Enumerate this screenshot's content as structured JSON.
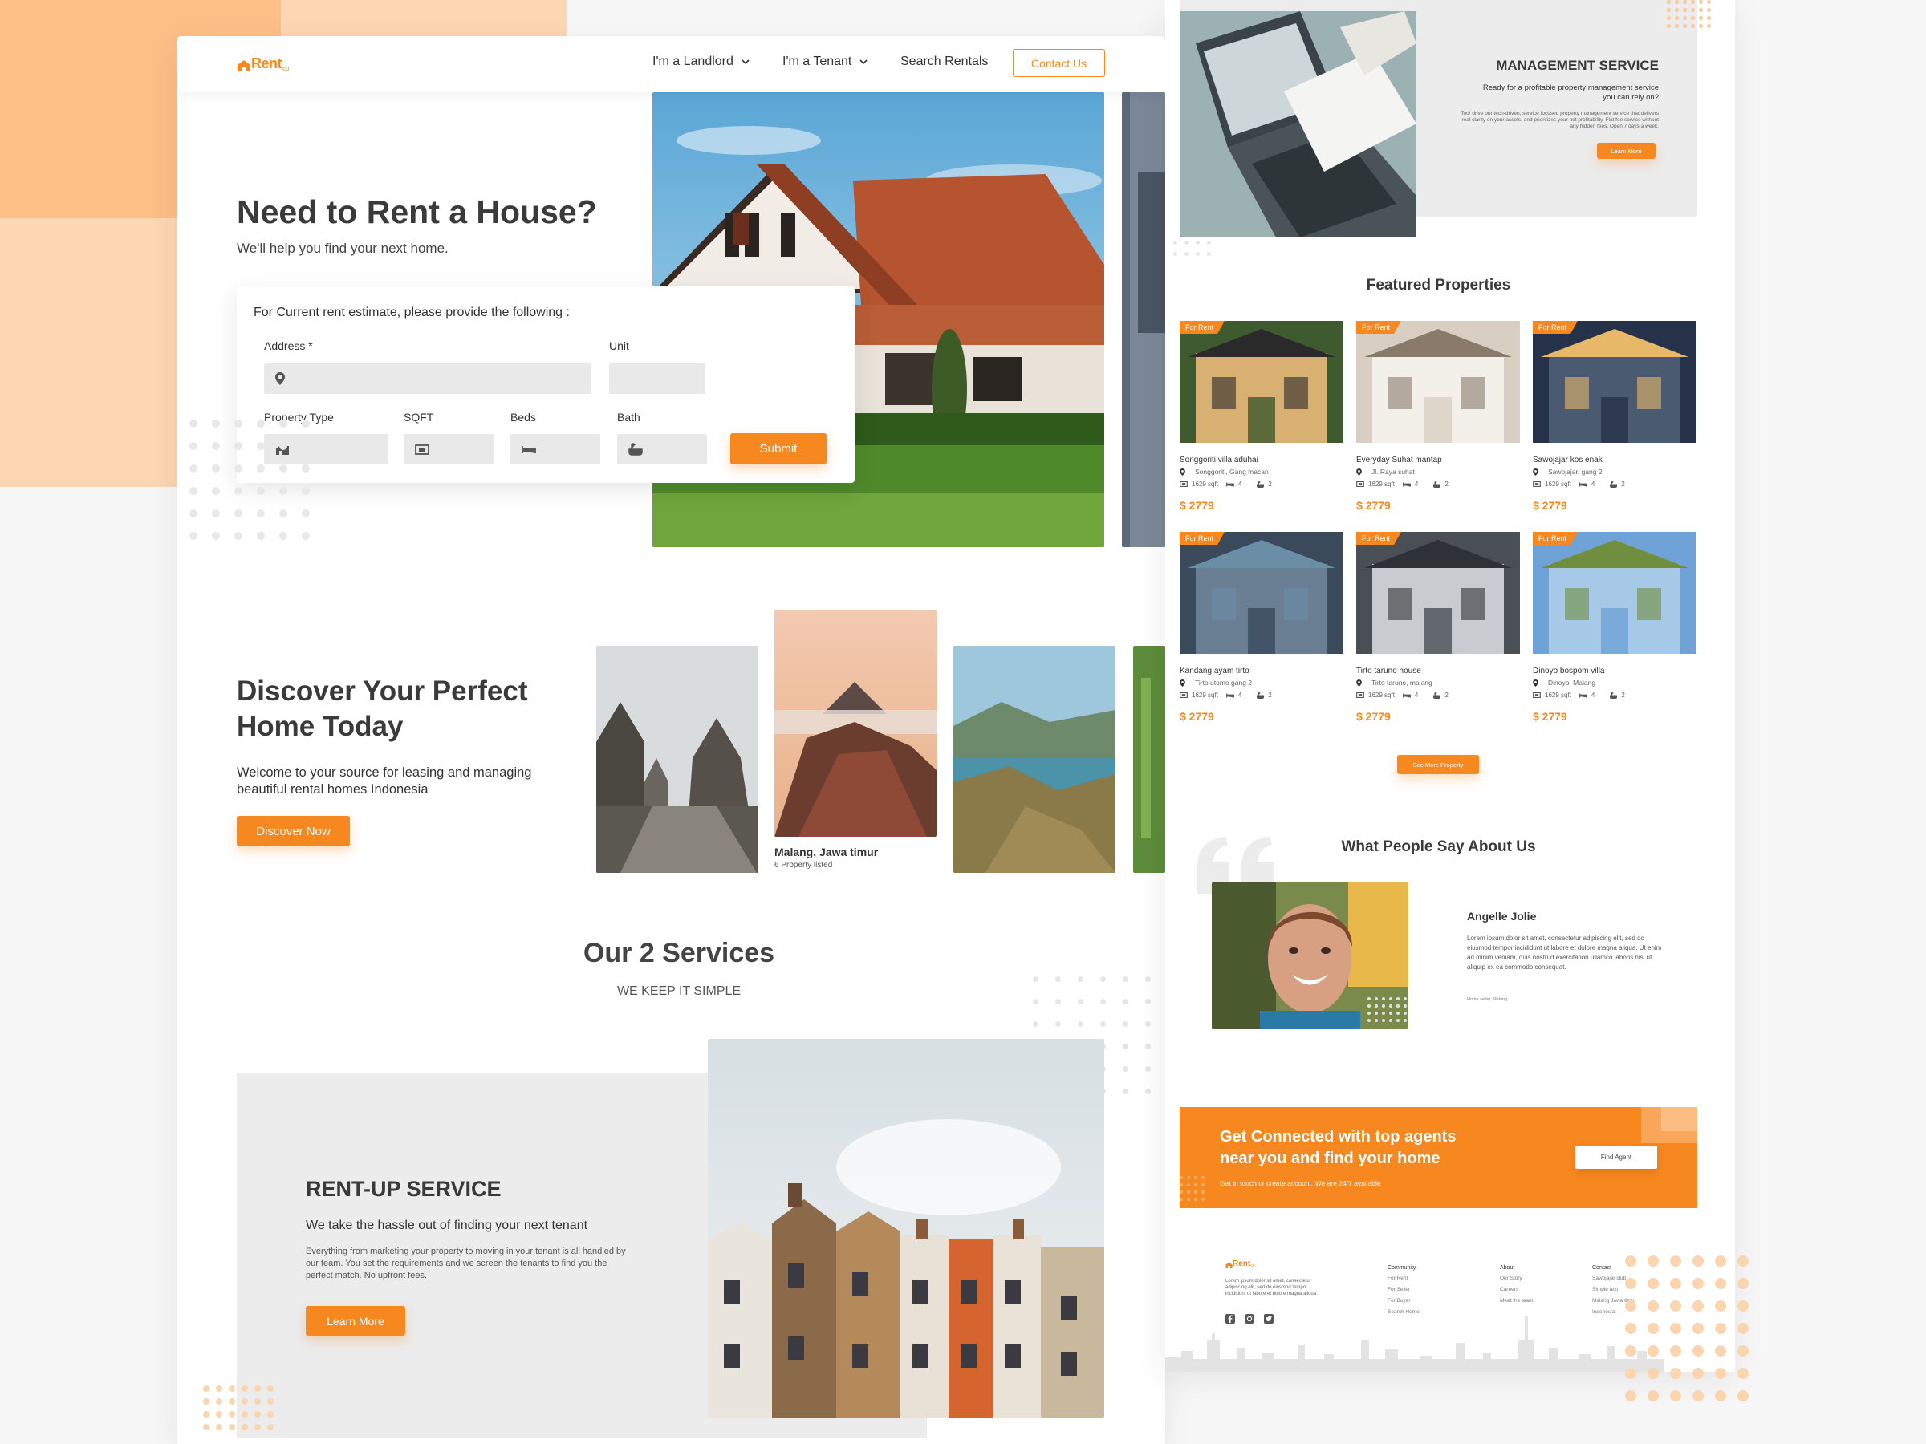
{
  "brand": {
    "logo": "Rent",
    "logo_suffix": "co",
    "accent": "#f7871f"
  },
  "nav": {
    "items": [
      {
        "label": "I'm a Landlord",
        "dropdown": true
      },
      {
        "label": "I'm a Tenant",
        "dropdown": true
      },
      {
        "label": "Search Rentals",
        "dropdown": false
      }
    ],
    "contact": "Contact Us"
  },
  "hero": {
    "title": "Need to Rent a House?",
    "subtitle": "We'll help you find your next home."
  },
  "estimate_form": {
    "intro": "For Current rent estimate, please provide the following :",
    "address_label": "Address *",
    "unit_label": "Unit",
    "property_type_label": "Property Type",
    "sqft_label": "SQFT",
    "beds_label": "Beds",
    "bath_label": "Bath",
    "submit": "Submit"
  },
  "discover": {
    "title_line1": "Discover Your Perfect",
    "title_line2": "Home Today",
    "text_line1": "Welcome to your source for leasing and managing",
    "text_line2": "beautiful rental homes Indonesia",
    "button": "Discover Now",
    "featured_location": "Malang, Jawa timur",
    "featured_count": "6 Property listed"
  },
  "services": {
    "title": "Our 2 Services",
    "subtitle": "WE KEEP IT SIMPLE",
    "rentup": {
      "title": "RENT-UP SERVICE",
      "subtitle": "We take the hassle out of finding your next tenant",
      "body": "Everything from marketing your property to moving in your tenant is all handled by our team. You set the requirements and we screen the tenants to find you the perfect match. No upfront fees.",
      "button": "Learn More"
    },
    "management": {
      "title": "MANAGEMENT SERVICE",
      "subtitle": "Ready for a profitable property management service you can rely on?",
      "body": "Too! drive our tech-driven, service focused property management service that delivers real clarity on your assets, and prioritizes your net profitability. Flat fee service without any hidden fees. Open 7 days a week.",
      "button": "Learn More"
    }
  },
  "featured": {
    "title": "Featured Properties",
    "tag": "For Rent",
    "see_more": "See More Property",
    "properties": [
      {
        "name": "Songgoriti villa aduhai",
        "location": "Songgoriti, Gang macan",
        "sqft": "1629 sqft",
        "beds": "4",
        "baths": "2",
        "price": "$ 2779"
      },
      {
        "name": "Everyday Suhat mantap",
        "location": "Jl. Raya suhat",
        "sqft": "1629 sqft",
        "beds": "4",
        "baths": "2",
        "price": "$ 2779"
      },
      {
        "name": "Sawojajar kos enak",
        "location": "Sawojajar, gang 2",
        "sqft": "1629 sqft",
        "beds": "4",
        "baths": "2",
        "price": "$ 2779"
      },
      {
        "name": "Kandang ayam tirto",
        "location": "Tirto utomo gang 2",
        "sqft": "1629 sqft",
        "beds": "4",
        "baths": "2",
        "price": "$ 2779"
      },
      {
        "name": "Tirto taruno house",
        "location": "Tirto taruno, malang",
        "sqft": "1629 sqft",
        "beds": "4",
        "baths": "2",
        "price": "$ 2779"
      },
      {
        "name": "Dinoyo bospom villa",
        "location": "Dinoyo, Malang",
        "sqft": "1629 sqft",
        "beds": "4",
        "baths": "2",
        "price": "$ 2779"
      }
    ]
  },
  "testimonial": {
    "title": "What People Say About Us",
    "name": "Angelle Jolie",
    "text": "Lorem ipsum dolor sit amet, consectetur adipiscing elit, sed do eiusmod tempor incididunt ut labore et dolore magna aliqua. Ut enim ad minim veniam, quis nostrud exercitation ullamco laboris nisi ut aliquip ex ea commodo consequat.",
    "role": "Home seller, Malang"
  },
  "agents_cta": {
    "title_line1": "Get Connected with top agents",
    "title_line2": "near you and find your home",
    "sub": "Get in touch or create account. We are 24/7 available",
    "button": "Find Agent"
  },
  "footer": {
    "about": "Lorem ipsum dolor sit amet, consectetur adipiscing elit, sed do eiusmod tempor incididunt ut labore et dolore magna aliqua.",
    "columns": [
      {
        "title": "Community",
        "items": [
          "For Rent",
          "For Seller",
          "For Buyer",
          "Search Home"
        ]
      },
      {
        "title": "About",
        "items": [
          "Our Story",
          "Careers",
          "Meet the team"
        ]
      },
      {
        "title": "Contact",
        "items": [
          "Sawojajar club",
          "Simple text",
          "Malang Jawa timur",
          "Indonesia"
        ]
      }
    ]
  }
}
